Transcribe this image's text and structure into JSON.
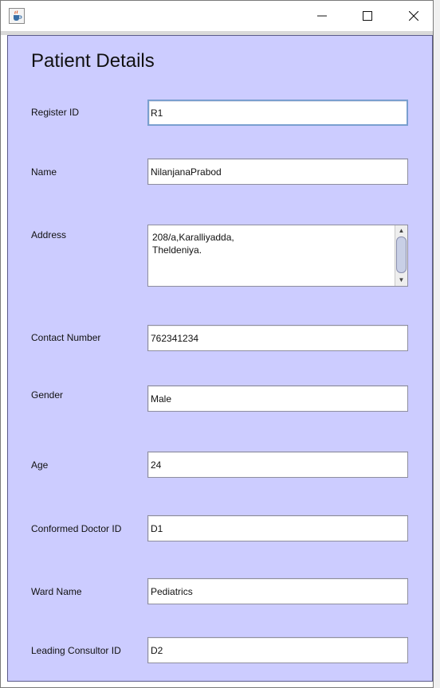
{
  "window": {
    "title": "",
    "icon": "java-coffee-cup-icon",
    "controls": [
      "minimize-icon",
      "maximize-icon",
      "close-icon"
    ]
  },
  "form": {
    "title": "Patient Details",
    "fields": {
      "register_id": {
        "label": "Register ID",
        "value": "R1"
      },
      "name": {
        "label": "Name",
        "value": "NilanjanaPrabod"
      },
      "address": {
        "label": "Address",
        "value": "208/a,Karalliyadda,\nTheldeniya."
      },
      "contact_number": {
        "label": "Contact Number",
        "value": "762341234"
      },
      "gender": {
        "label": "Gender",
        "value": "Male"
      },
      "age": {
        "label": "Age",
        "value": "24"
      },
      "conformed_doctor_id": {
        "label": "Conformed Doctor ID",
        "value": "D1"
      },
      "ward_name": {
        "label": "Ward Name",
        "value": "Pediatrics"
      },
      "leading_consultor_id": {
        "label": "Leading Consultor ID",
        "value": "D2"
      }
    }
  },
  "colors": {
    "panel_background": "#ccccff",
    "field_focus_border": "#7a9fcf",
    "field_border": "#8e8e9e"
  }
}
